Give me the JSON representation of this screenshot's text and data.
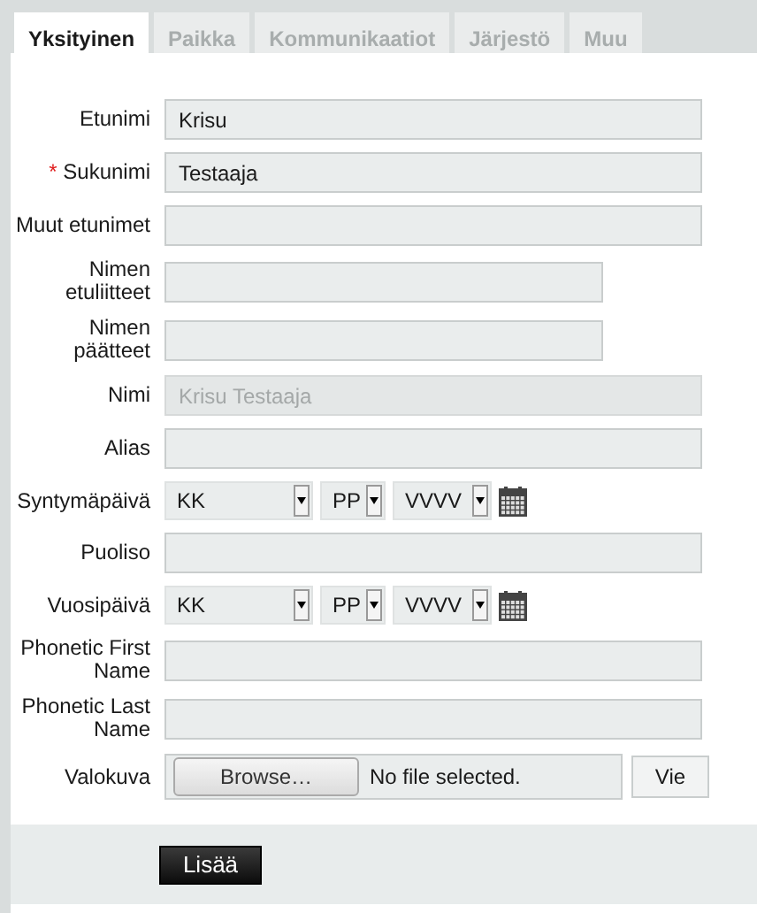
{
  "tabs": [
    {
      "label": "Yksityinen",
      "selected": true
    },
    {
      "label": "Paikka",
      "selected": false
    },
    {
      "label": "Kommunikaatiot",
      "selected": false
    },
    {
      "label": "Järjestö",
      "selected": false
    },
    {
      "label": "Muu",
      "selected": false
    }
  ],
  "fields": [
    {
      "kind": "text",
      "label": "Etunimi",
      "value": "Krisu",
      "disabled": false,
      "short": false
    },
    {
      "kind": "text",
      "required_mark": "*",
      "label": "Sukunimi",
      "value": "Testaaja",
      "disabled": false,
      "short": false
    },
    {
      "kind": "text",
      "label": "Muut etunimet",
      "disabled": false,
      "short": false
    },
    {
      "kind": "text",
      "label": "Nimen etuliitteet",
      "disabled": false,
      "short": true
    },
    {
      "kind": "text",
      "label": "Nimen päätteet",
      "disabled": false,
      "short": true
    },
    {
      "kind": "text",
      "label": "Nimi",
      "value": "Krisu Testaaja",
      "disabled": true,
      "short": false
    },
    {
      "kind": "text",
      "label": "Alias",
      "disabled": false,
      "short": false
    },
    {
      "kind": "date",
      "label": "Syntymäpäivä",
      "month": "KK",
      "day": "PP",
      "year": "VVVV"
    },
    {
      "kind": "text",
      "label": "Puoliso",
      "disabled": false,
      "short": false
    },
    {
      "kind": "date",
      "label": "Vuosipäivä",
      "month": "KK",
      "day": "PP",
      "year": "VVVV"
    },
    {
      "kind": "text",
      "label": "Phonetic First Name",
      "disabled": false,
      "short": false
    },
    {
      "kind": "text",
      "label": "Phonetic Last Name",
      "disabled": false,
      "short": false
    },
    {
      "kind": "file",
      "label": "Valokuva",
      "browse": "Browse…",
      "status": "No file selected.",
      "upload": "Vie"
    }
  ],
  "submit": "Lisää"
}
